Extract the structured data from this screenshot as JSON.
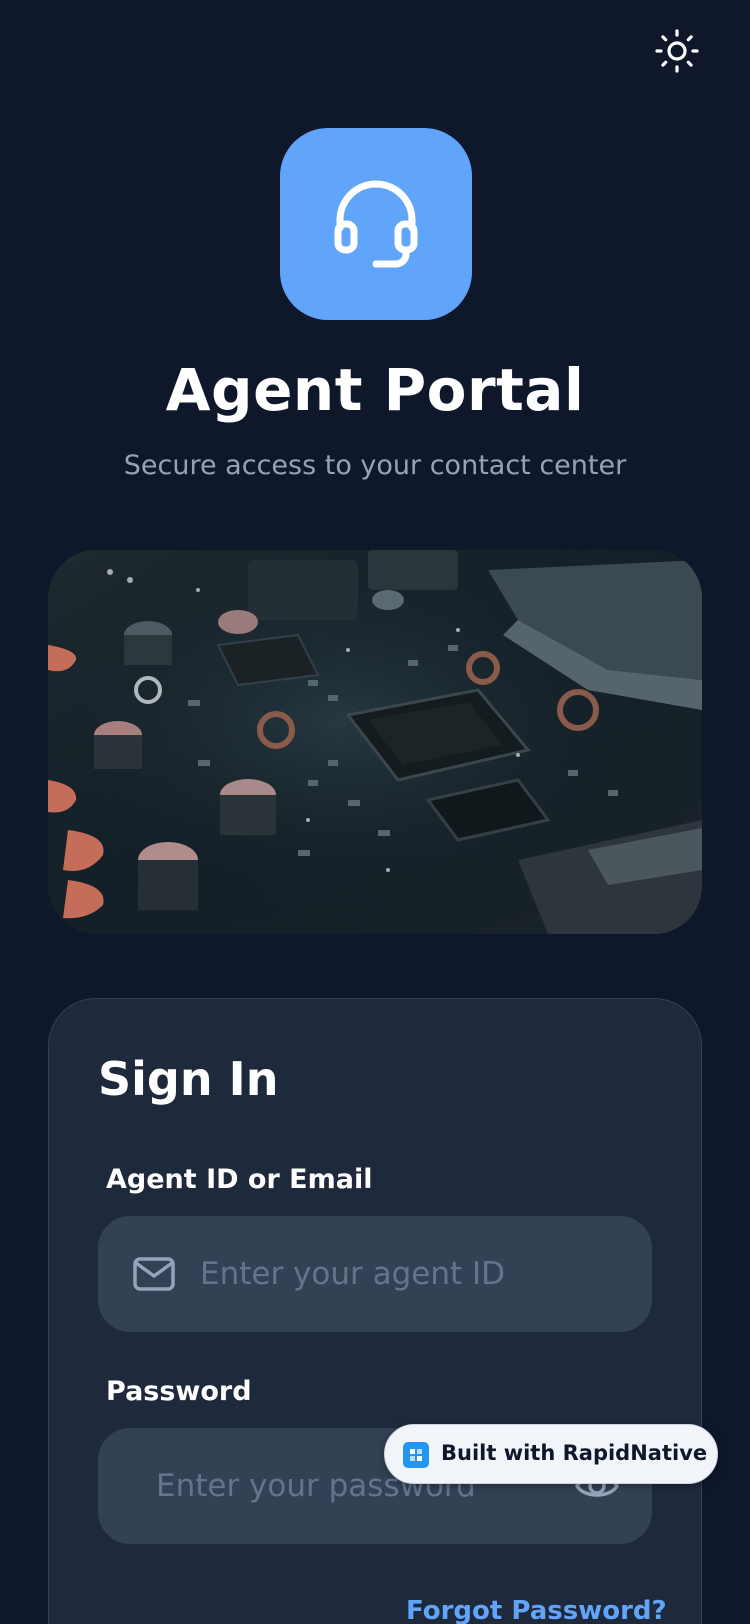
{
  "header": {
    "theme_toggle_icon": "sun-icon"
  },
  "app": {
    "icon": "headset-icon",
    "title": "Agent Portal",
    "subtitle": "Secure access to your contact center",
    "accent_color": "#60a5fa"
  },
  "hero": {
    "image_subject": "circuit board close-up"
  },
  "signin": {
    "title": "Sign In",
    "agent_field": {
      "label": "Agent ID or Email",
      "placeholder": "Enter your agent ID",
      "value": "",
      "icon": "mail-icon"
    },
    "password_field": {
      "label": "Password",
      "placeholder": "Enter your password",
      "value": "",
      "icon": "eye-icon"
    },
    "forgot_link": "Forgot Password?"
  },
  "badge": {
    "text": "Built with RapidNative",
    "icon": "rapidnative-logo-icon"
  },
  "colors": {
    "background": "#0f172a",
    "card": "#1e293b",
    "input": "#334155",
    "muted_text": "#94a3b8",
    "link": "#60a5fa"
  }
}
